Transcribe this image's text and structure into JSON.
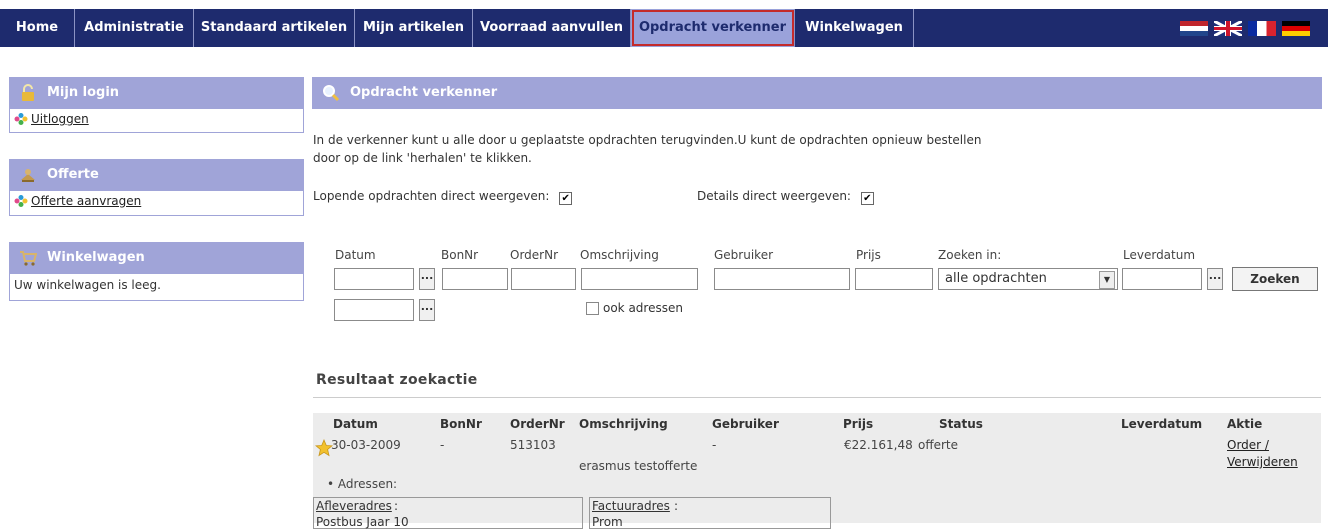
{
  "nav": {
    "items": [
      "Home",
      "Administratie",
      "Standaard artikelen",
      "Mijn artikelen",
      "Voorraad aanvullen",
      "Opdracht verkenner",
      "Winkelwagen"
    ],
    "active": "Opdracht verkenner"
  },
  "flags": [
    "Nederlands",
    "English",
    "Français",
    "Deutsch"
  ],
  "sidebar": {
    "login": {
      "title": "Mijn login",
      "link": "Uitloggen"
    },
    "offerte": {
      "title": "Offerte",
      "link": "Offerte aanvragen"
    },
    "cart": {
      "title": "Winkelwagen",
      "text": "Uw winkelwagen is leeg."
    }
  },
  "main": {
    "title": "Opdracht verkenner",
    "intro": "In de verkenner kunt u alle door u geplaatste opdrachten terugvinden.U kunt de opdrachten opnieuw bestellen door op de link 'herhalen' te klikken.",
    "opt_running": "Lopende opdrachten direct weergeven:",
    "opt_details": "Details direct weergeven:",
    "opt_running_checked": true,
    "opt_details_checked": true
  },
  "search": {
    "labels": {
      "date": "Datum",
      "bon": "BonNr",
      "order": "OrderNr",
      "desc": "Omschrijving",
      "user": "Gebruiker",
      "price": "Prijs",
      "searchin": "Zoeken in:",
      "delivery": "Leverdatum"
    },
    "searchin_value": "alle opdrachten",
    "also_addresses": "ook adressen",
    "button": "Zoeken",
    "picker": "..."
  },
  "results": {
    "title": "Resultaat zoekactie",
    "headers": {
      "date": "Datum",
      "bon": "BonNr",
      "order": "OrderNr",
      "desc": "Omschrijving",
      "user": "Gebruiker",
      "price": "Prijs",
      "status": "Status",
      "delivery": "Leverdatum",
      "action": "Aktie"
    },
    "row": {
      "date": "30-03-2009",
      "bon": "-",
      "order": "513103",
      "desc": "erasmus testofferte",
      "user": "-",
      "price": "€22.161,48",
      "status": "offerte",
      "action1": "Order /",
      "action2": "Verwijderen",
      "addresses_label": "• Adressen:",
      "delivery_address_label": "Afleveradres",
      "delivery_address_value": "Postbus Jaar 10",
      "invoice_address_label": "Factuuradres",
      "invoice_address_value": "Prom"
    }
  },
  "colors": {
    "nav": "#1e2b6e",
    "panel": "#a0a4d8",
    "active_outline": "#c42b2b"
  }
}
